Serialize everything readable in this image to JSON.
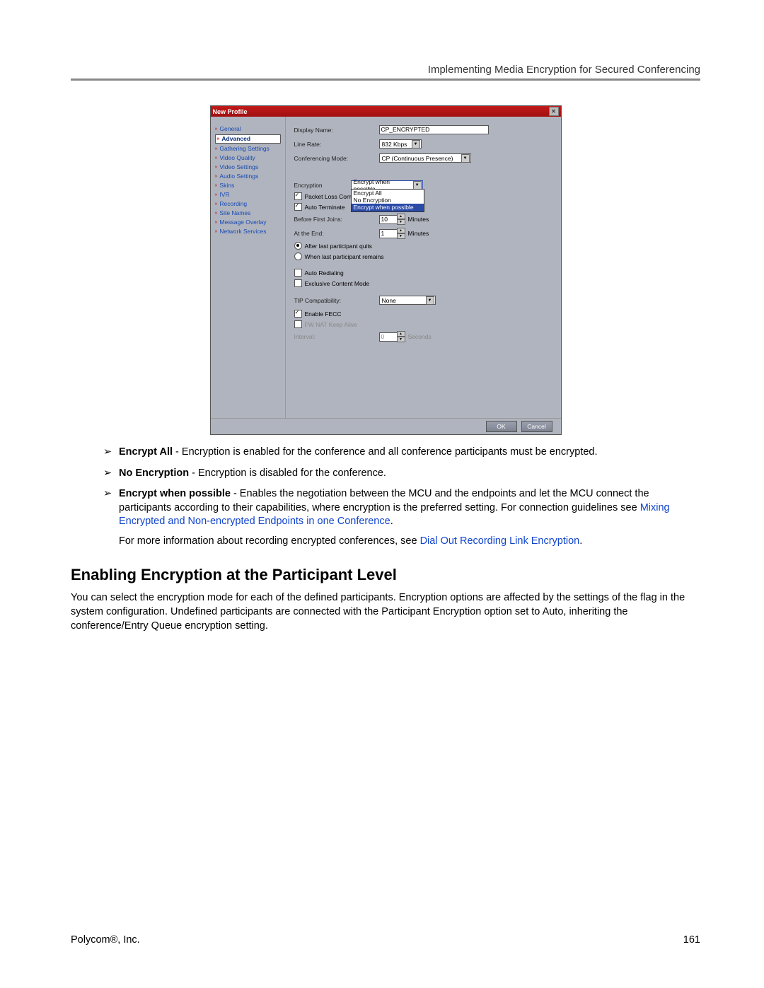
{
  "doc": {
    "header": "Implementing Media Encryption for Secured Conferencing",
    "footer_left": "Polycom®, Inc.",
    "footer_right": "161",
    "section_heading": "Enabling Encryption at the Participant Level",
    "encrypt_all_label": "Encrypt All",
    "encrypt_all_text": " - Encryption is enabled for the conference and all conference participants must be encrypted.",
    "no_enc_label": "No Encryption",
    "no_enc_text": " - Encryption is disabled for the conference.",
    "ewp_label": "Encrypt when possible",
    "ewp_text": " - Enables the negotiation between the MCU and the endpoints and let the MCU connect the participants according to their capabilities, where encryption is the preferred setting. For connection guidelines see ",
    "ewp_link": "Mixing Encrypted and Non-encrypted Endpoints in one Conference",
    "more_info": "For more information about recording encrypted conferences, see ",
    "more_info_link": "Dial Out Recording Link Encryption",
    "section_body": "You can select the encryption mode for each of the defined participants. Encryption options are affected by the settings of the flag in the system configuration. Undefined participants are connected with the Participant Encryption option set to Auto, inheriting the conference/Entry Queue encryption setting."
  },
  "dialog": {
    "title": "New Profile",
    "sidebar": [
      "General",
      "Advanced",
      "Gathering Settings",
      "Video Quality",
      "Video Settings",
      "Audio Settings",
      "Skins",
      "IVR",
      "Recording",
      "Site Names",
      "Message Overlay",
      "Network Services"
    ],
    "sidebar_selected_index": 1,
    "labels": {
      "display_name": "Display Name:",
      "line_rate": "Line Rate:",
      "conf_mode": "Conferencing Mode:",
      "encryption": "Encryption",
      "pkt_loss": "Packet Loss Compens",
      "auto_term": "Auto Terminate",
      "before_first": "Before First Joins:",
      "at_end": "At the End:",
      "after_last": "After last participant quits",
      "when_last": "When last participant remains",
      "auto_redial": "Auto Redialing",
      "exclusive": "Exclusive Content Mode",
      "tip": "TIP Compatibility:",
      "fecc": "Enable FECC",
      "fw_nat": "FW NAT Keep Alive",
      "interval": "Interval:",
      "minutes": "Minutes",
      "seconds": "Seconds"
    },
    "values": {
      "display_name": "CP_ENCRYPTED",
      "line_rate": "832 Kbps",
      "conf_mode": "CP (Continuous Presence)",
      "encryption_selected": "Encrypt when possible",
      "encryption_options": [
        "Encrypt All",
        "No Encryption",
        "Encrypt when possible"
      ],
      "before_first": "10",
      "at_end": "1",
      "tip": "None",
      "interval": "0"
    },
    "buttons": {
      "ok": "OK",
      "cancel": "Cancel"
    }
  }
}
